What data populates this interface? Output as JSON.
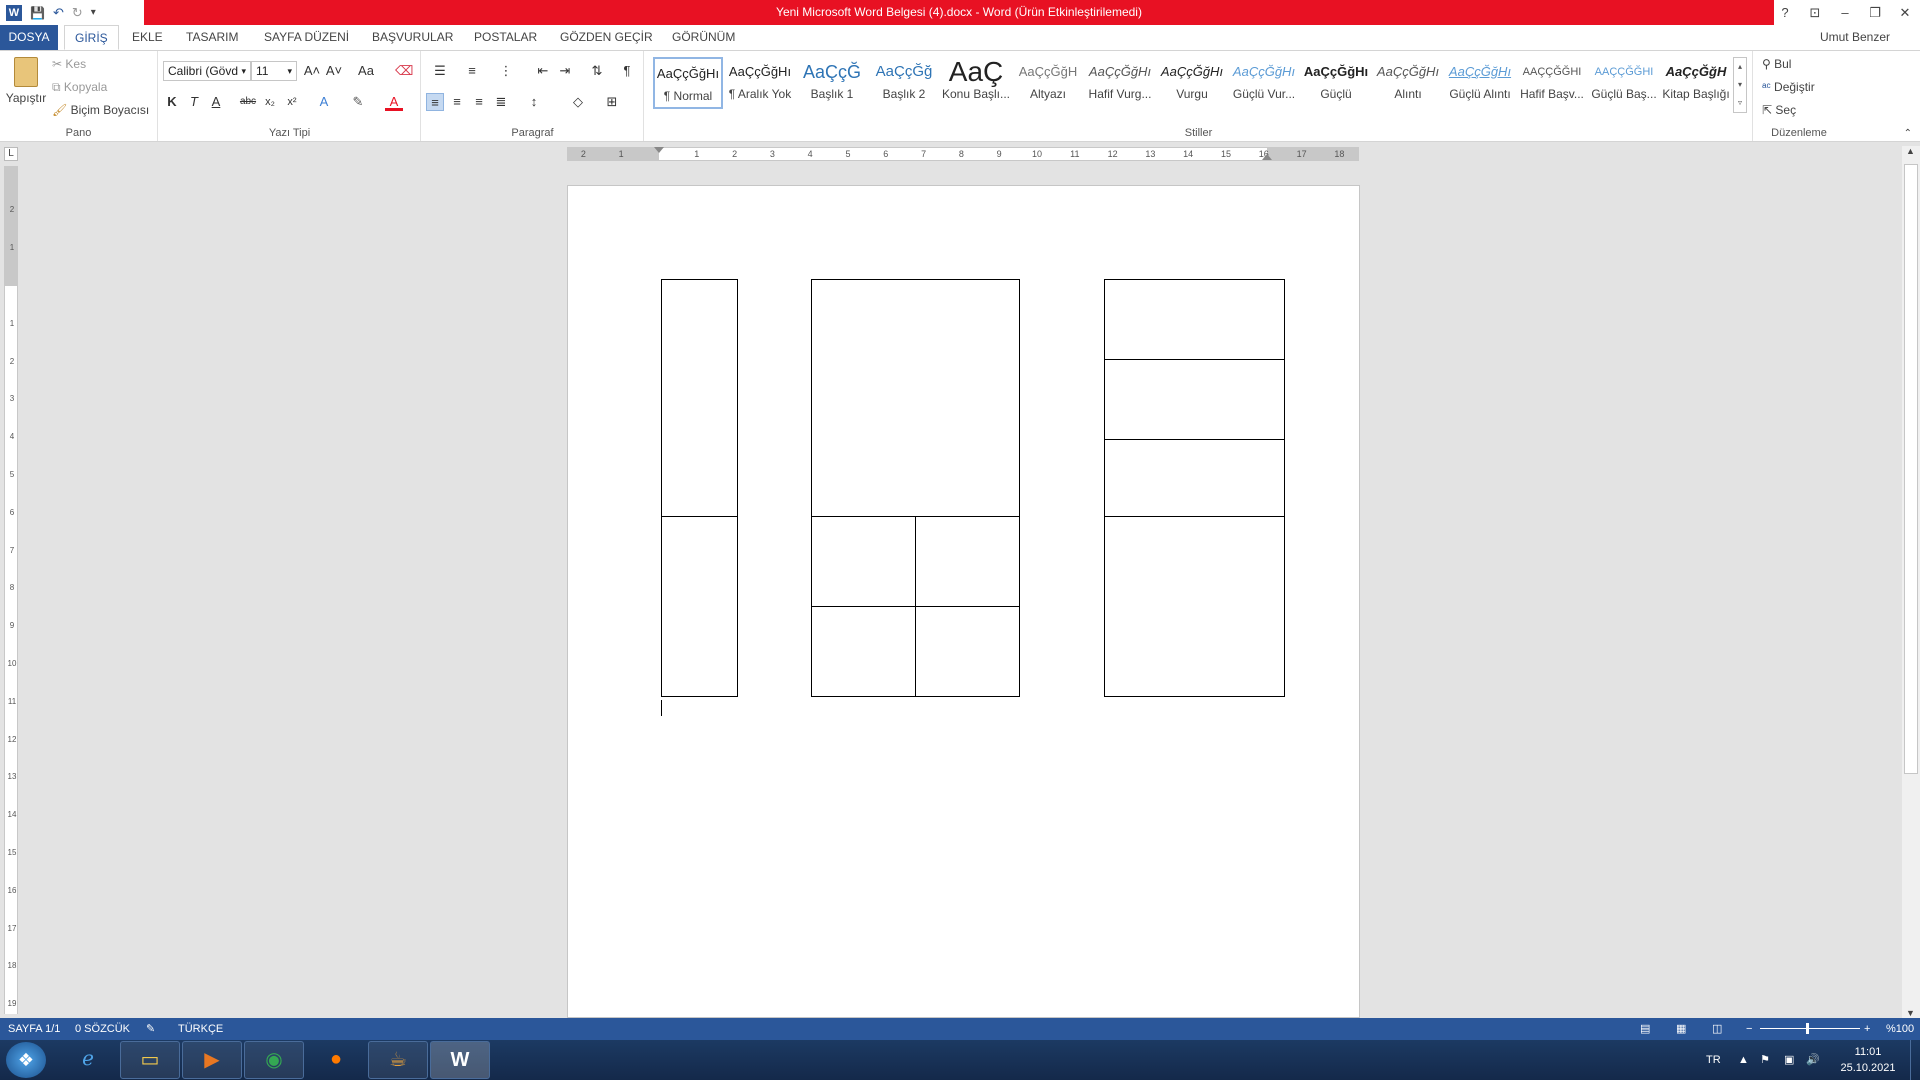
{
  "window": {
    "title": "Yeni Microsoft Word Belgesi (4).docx -  Word (Ürün Etkinleştirilemedi)",
    "help": "?",
    "restore_ribbon": "⊡",
    "minimize": "–",
    "maximize": "❐",
    "close": "✕"
  },
  "qat": {
    "word_icon": "W",
    "save_icon": "💾",
    "undo_icon": "↶",
    "redo_icon": "↻",
    "more_icon": "▾"
  },
  "tabs": [
    "DOSYA",
    "GİRİŞ",
    "EKLE",
    "TASARIM",
    "SAYFA DÜZENİ",
    "BAŞVURULAR",
    "POSTALAR",
    "GÖZDEN GEÇİR",
    "GÖRÜNÜM"
  ],
  "user": "Umut Benzer",
  "clipboard": {
    "paste": "Yapıştır",
    "cut": "Kes",
    "copy": "Kopyala",
    "format_painter": "Biçim Boyacısı",
    "label": "Pano"
  },
  "font": {
    "name": "Calibri (Gövd",
    "size": "11",
    "label": "Yazı Tipi",
    "bold": "K",
    "italic": "T",
    "underline": "A",
    "strike": "abc",
    "sub": "x₂",
    "sup": "x²",
    "grow": "A˄",
    "shrink": "A˅",
    "case": "Aa",
    "text_effect": "A",
    "font_color": "A"
  },
  "paragraph": {
    "label": "Paragraf",
    "pilcrow": "¶"
  },
  "styles": {
    "label": "Stiller",
    "items": [
      {
        "sample": "AaÇçĞğHı",
        "name": "¶ Normal"
      },
      {
        "sample": "AaÇçĞğHı",
        "name": "¶ Aralık Yok"
      },
      {
        "sample": "AaÇçĞ",
        "name": "Başlık 1"
      },
      {
        "sample": "AaÇçĞğ",
        "name": "Başlık 2"
      },
      {
        "sample": "AaÇ",
        "name": "Konu Başlı..."
      },
      {
        "sample": "AaÇçĞğH",
        "name": "Altyazı"
      },
      {
        "sample": "AaÇçĞğHı",
        "name": "Hafif Vurg..."
      },
      {
        "sample": "AaÇçĞğHı",
        "name": "Vurgu"
      },
      {
        "sample": "AaÇçĞğHı",
        "name": "Güçlü Vur..."
      },
      {
        "sample": "AaÇçĞğHı",
        "name": "Güçlü"
      },
      {
        "sample": "AaÇçĞğHı",
        "name": "Alıntı"
      },
      {
        "sample": "AaÇçĞğHı",
        "name": "Güçlü Alıntı"
      },
      {
        "sample": "AAÇÇĞĞHI",
        "name": "Hafif Başv..."
      },
      {
        "sample": "AAÇÇĞĞHI",
        "name": "Güçlü Baş..."
      },
      {
        "sample": "AaÇçĞğH",
        "name": "Kitap Başlığı"
      }
    ]
  },
  "editing": {
    "find": "Bul",
    "replace": "Değiştir",
    "select": "Seç",
    "label": "Düzenleme"
  },
  "ruler": {
    "corner": "L",
    "h_labels": [
      "2",
      "1",
      "1",
      "2",
      "3",
      "4",
      "5",
      "6",
      "7",
      "8",
      "9",
      "10",
      "11",
      "12",
      "13",
      "14",
      "15",
      "16",
      "17",
      "18"
    ],
    "v_labels": [
      "2",
      "1",
      "1",
      "2",
      "3",
      "4",
      "5",
      "6",
      "7",
      "8",
      "9",
      "10",
      "11",
      "12",
      "13",
      "14",
      "15",
      "16",
      "17",
      "18",
      "19"
    ]
  },
  "status": {
    "page": "SAYFA 1/1",
    "words": "0 SÖZCÜK",
    "lang": "TÜRKÇE",
    "zoom": "%100"
  },
  "taskbar": {
    "lang": "TR",
    "time": "11:01",
    "date": "25.10.2021"
  }
}
